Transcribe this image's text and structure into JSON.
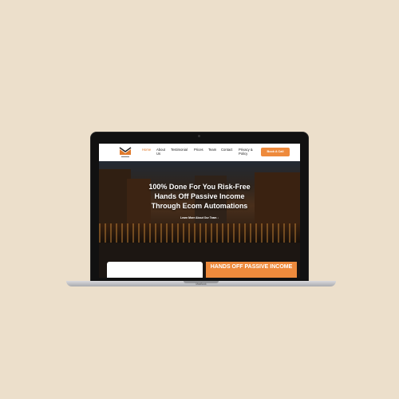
{
  "device": {
    "brand": "MacBook"
  },
  "nav": {
    "items": [
      {
        "label": "Home",
        "active": true
      },
      {
        "label": "About Us"
      },
      {
        "label": "Testimonial"
      },
      {
        "label": "Prices"
      },
      {
        "label": "Team"
      },
      {
        "label": "Contact"
      },
      {
        "label": "Privacy & Policy"
      }
    ],
    "cta_label": "Book A Call"
  },
  "hero": {
    "title_lines": [
      "100% Done For You Risk-Free",
      "Hands Off Passive Income",
      "Through Ecom Automations"
    ],
    "link": "Learn More About Our Team ↓"
  },
  "section": {
    "orange_text": "HANDS OFF PASSIVE INCOME"
  },
  "colors": {
    "accent": "#ee8a3c",
    "background": "#ecdfcb"
  }
}
